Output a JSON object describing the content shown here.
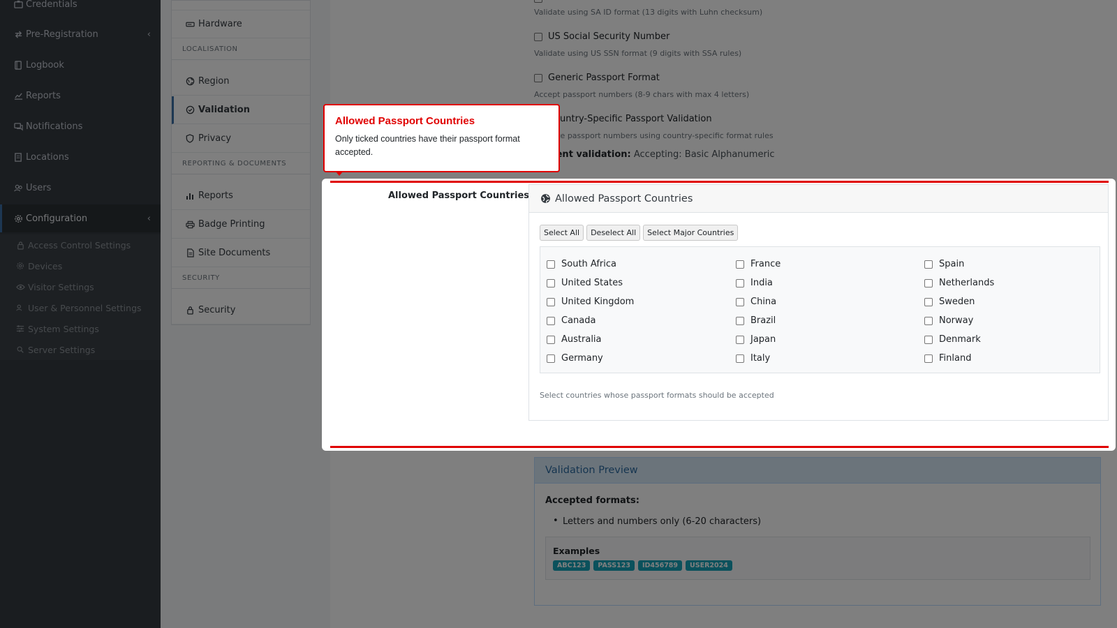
{
  "sidebar": {
    "items": [
      {
        "label": "Credentials",
        "icon": "id-card-icon"
      },
      {
        "label": "Pre-Registration",
        "icon": "exchange-icon"
      },
      {
        "label": "Logbook",
        "icon": "book-icon"
      },
      {
        "label": "Reports",
        "icon": "chart-icon"
      },
      {
        "label": "Notifications",
        "icon": "comments-icon"
      },
      {
        "label": "Locations",
        "icon": "building-icon"
      },
      {
        "label": "Users",
        "icon": "users-icon"
      },
      {
        "label": "Configuration",
        "icon": "gear-icon"
      }
    ],
    "subitems": [
      {
        "label": "Access Control Settings",
        "icon": "lock-icon"
      },
      {
        "label": "Devices",
        "icon": "gear-icon"
      },
      {
        "label": "Visitor Settings",
        "icon": "eye-icon"
      },
      {
        "label": "User & Personnel Settings",
        "icon": "users-icon"
      },
      {
        "label": "System Settings",
        "icon": "sliders-icon"
      },
      {
        "label": "Server Settings",
        "icon": "server-icon"
      }
    ]
  },
  "settings_nav": {
    "hardware": "Hardware",
    "localisation_header": "LOCALISATION",
    "region": "Region",
    "validation": "Validation",
    "privacy": "Privacy",
    "reporting_header": "REPORTING & DOCUMENTS",
    "reports": "Reports",
    "badge_printing": "Badge Printing",
    "site_documents": "Site Documents",
    "security_header": "SECURITY",
    "security": "Security"
  },
  "validation_options": {
    "sa_id_help": "Validate using SA ID format (13 digits with Luhn checksum)",
    "us_ssn_label": "US Social Security Number",
    "us_ssn_help": "Validate using US SSN format (9 digits with SSA rules)",
    "passport_label": "Generic Passport Format",
    "passport_help": "Accept passport numbers (8-9 chars with max 4 letters)",
    "country_specific_label": "Country-Specific Passport Validation",
    "country_specific_help": "Validate passport numbers using country-specific format rules",
    "current_label": "Current validation:",
    "current_value": "Accepting: Basic Alphanumeric"
  },
  "allowed_countries": {
    "row_label": "Allowed Passport Countries",
    "card_title": "Allowed Passport Countries",
    "select_all": "Select All",
    "deselect_all": "Deselect All",
    "select_major": "Select Major Countries",
    "countries": [
      "South Africa",
      "United States",
      "United Kingdom",
      "Canada",
      "Australia",
      "Germany",
      "France",
      "India",
      "China",
      "Brazil",
      "Japan",
      "Italy",
      "Spain",
      "Netherlands",
      "Sweden",
      "Norway",
      "Denmark",
      "Finland"
    ],
    "help": "Select countries whose passport formats should be accepted"
  },
  "preview": {
    "title": "Validation Preview",
    "accepted_label": "Accepted formats:",
    "accepted_item": "Letters and numbers only (6-20 characters)",
    "examples_title": "Examples",
    "examples": [
      "ABC123",
      "PASS123",
      "ID456789",
      "USER2024"
    ]
  },
  "tooltip": {
    "title": "Allowed Passport Countries",
    "body": "Only ticked countries have their passport format accepted."
  },
  "colors": {
    "highlight": "#e00000",
    "sidebar_bg": "#343a40",
    "accent": "#3a6ea5",
    "tag": "#17a2b8"
  }
}
